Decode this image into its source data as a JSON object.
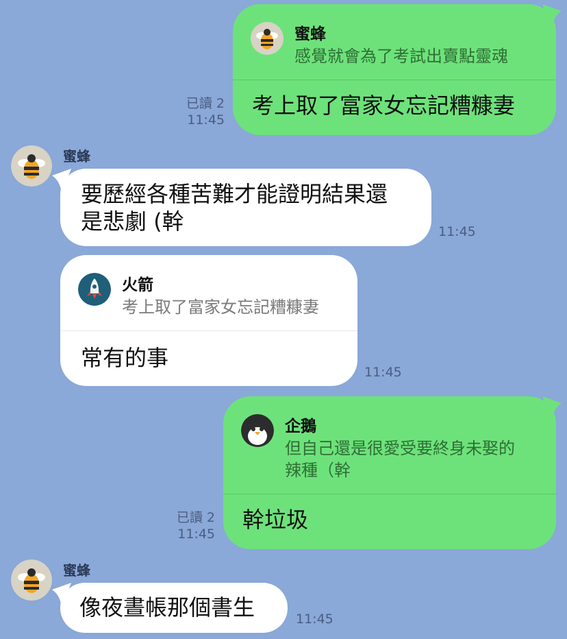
{
  "messages": [
    {
      "direction": "out",
      "read_label": "已讀 2",
      "time": "11:45",
      "quote": {
        "sender": "蜜蜂",
        "text": "感覺就會為了考試出賣點靈魂",
        "avatar_icon": "bee-icon"
      },
      "text": "考上取了富家女忘記糟糠妻"
    },
    {
      "direction": "in",
      "sender": "蜜蜂",
      "avatar_icon": "bee-icon",
      "time": "11:45",
      "text": "要歷經各種苦難才能證明結果還\n是悲劇 (幹"
    },
    {
      "direction": "in",
      "time": "11:45",
      "quote": {
        "sender": "火箭",
        "text": "考上取了富家女忘記糟糠妻",
        "avatar_icon": "rocket-icon"
      },
      "text": "常有的事"
    },
    {
      "direction": "out",
      "read_label": "已讀 2",
      "time": "11:45",
      "quote": {
        "sender": "企鵝",
        "text": "但自己還是很愛受要終身未娶的\n辣種（幹",
        "avatar_icon": "penguin-icon"
      },
      "text": "幹垃圾"
    },
    {
      "direction": "in",
      "sender": "蜜蜂",
      "avatar_icon": "bee-icon",
      "time": "11:45",
      "text": "像夜晝帳那個書生"
    }
  ],
  "colors": {
    "background": "#8aa8d8",
    "outgoing_bubble": "#6de27a",
    "incoming_bubble": "#ffffff"
  }
}
